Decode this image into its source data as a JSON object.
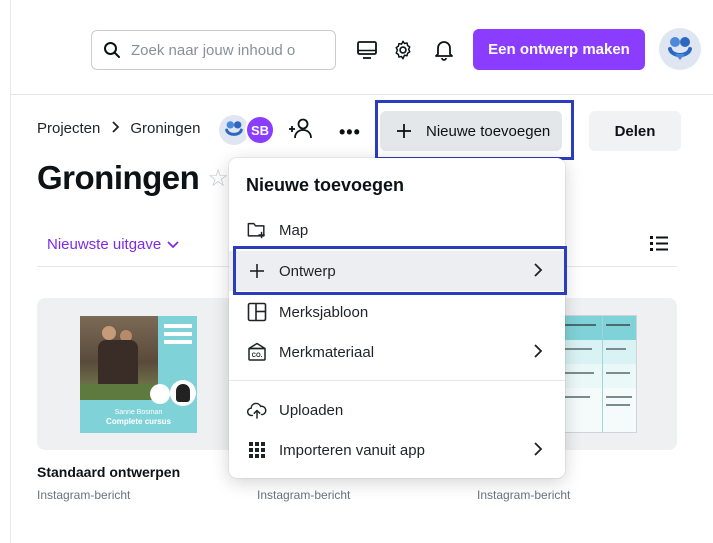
{
  "search": {
    "placeholder": "Zoek naar jouw inhoud o"
  },
  "header": {
    "create_label": "Een ontwerp maken"
  },
  "breadcrumb": {
    "root": "Projecten",
    "current": "Groningen"
  },
  "collaborators": {
    "initials": "SB"
  },
  "actions": {
    "add_label": "Nieuwe toevoegen",
    "share_label": "Delen"
  },
  "page": {
    "title": "Groningen",
    "sort_label": "Nieuwste uitgave"
  },
  "menu": {
    "title": "Nieuwe toevoegen",
    "items": [
      {
        "label": "Map",
        "icon": "folder-plus-icon"
      },
      {
        "label": "Ontwerp",
        "icon": "plus-icon"
      },
      {
        "label": "Merksjabloon",
        "icon": "template-icon"
      },
      {
        "label": "Merkmateriaal",
        "icon": "brand-kit-icon"
      },
      {
        "label": "Uploaden",
        "icon": "cloud-upload-icon"
      },
      {
        "label": "Importeren vanuit app",
        "icon": "apps-grid-icon"
      }
    ]
  },
  "cards": [
    {
      "title": "Standaard ontwerpen",
      "subtitle": "Instagram-bericht",
      "thumb_text": [
        "Sanne Bosman",
        "Complete cursus"
      ]
    },
    {
      "title": "",
      "subtitle": "Instagram-bericht"
    },
    {
      "title": ":",
      "subtitle": "Instagram-bericht"
    }
  ],
  "colors": {
    "accent": "#8b3dff",
    "highlight": "#2b3dbd",
    "sort": "#7d2ae8"
  }
}
